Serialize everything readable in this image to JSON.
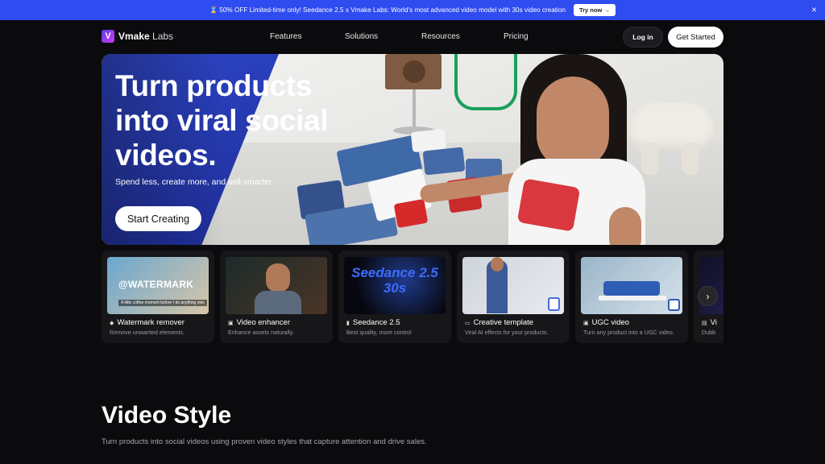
{
  "promo": {
    "icon": "hourglass-icon",
    "text": "50% OFF Limited-time only! Seedance 2.5 x Vmake Labs: World's most advanced video model with 30s video creation",
    "try_label": "Try now →",
    "close_icon": "×"
  },
  "nav": {
    "logo_letter": "V",
    "brand_bold": "Vmake",
    "brand_light": " Labs",
    "menu": [
      "Features",
      "Solutions",
      "Resources",
      "Pricing"
    ],
    "login_label": "Log in",
    "get_started_label": "Get Started"
  },
  "hero": {
    "headline": "Turn products into viral social videos.",
    "subtitle": "Spend less, create more, and sell smarter.",
    "cta_label": "Start Creating",
    "accent_color": "#2e46c9"
  },
  "tools": [
    {
      "title": "Watermark remover",
      "desc": "Remove unwanted elements.",
      "icon": "eraser-icon",
      "thumb_text": "@WATERMARK",
      "thumb_caption": "A little coffee moment before I do anything else"
    },
    {
      "title": "Video enhancer",
      "desc": "Enhance assets naturally.",
      "icon": "enhance-icon"
    },
    {
      "title": "Seedance 2.5",
      "desc": "Best quality, more control",
      "icon": "bars-icon",
      "thumb_text": "Seedance 2.5\n30s"
    },
    {
      "title": "Creative template",
      "desc": "Viral AI effects for your products.",
      "icon": "template-icon"
    },
    {
      "title": "UGC video",
      "desc": "Turn any product into a UGC video.",
      "icon": "ugc-icon"
    },
    {
      "title": "Vi",
      "desc": "Dubb",
      "icon": "dub-icon"
    }
  ],
  "next_icon": "›",
  "section": {
    "title": "Video Style",
    "subtitle": "Turn products into social videos using proven video styles that capture attention and drive sales."
  }
}
